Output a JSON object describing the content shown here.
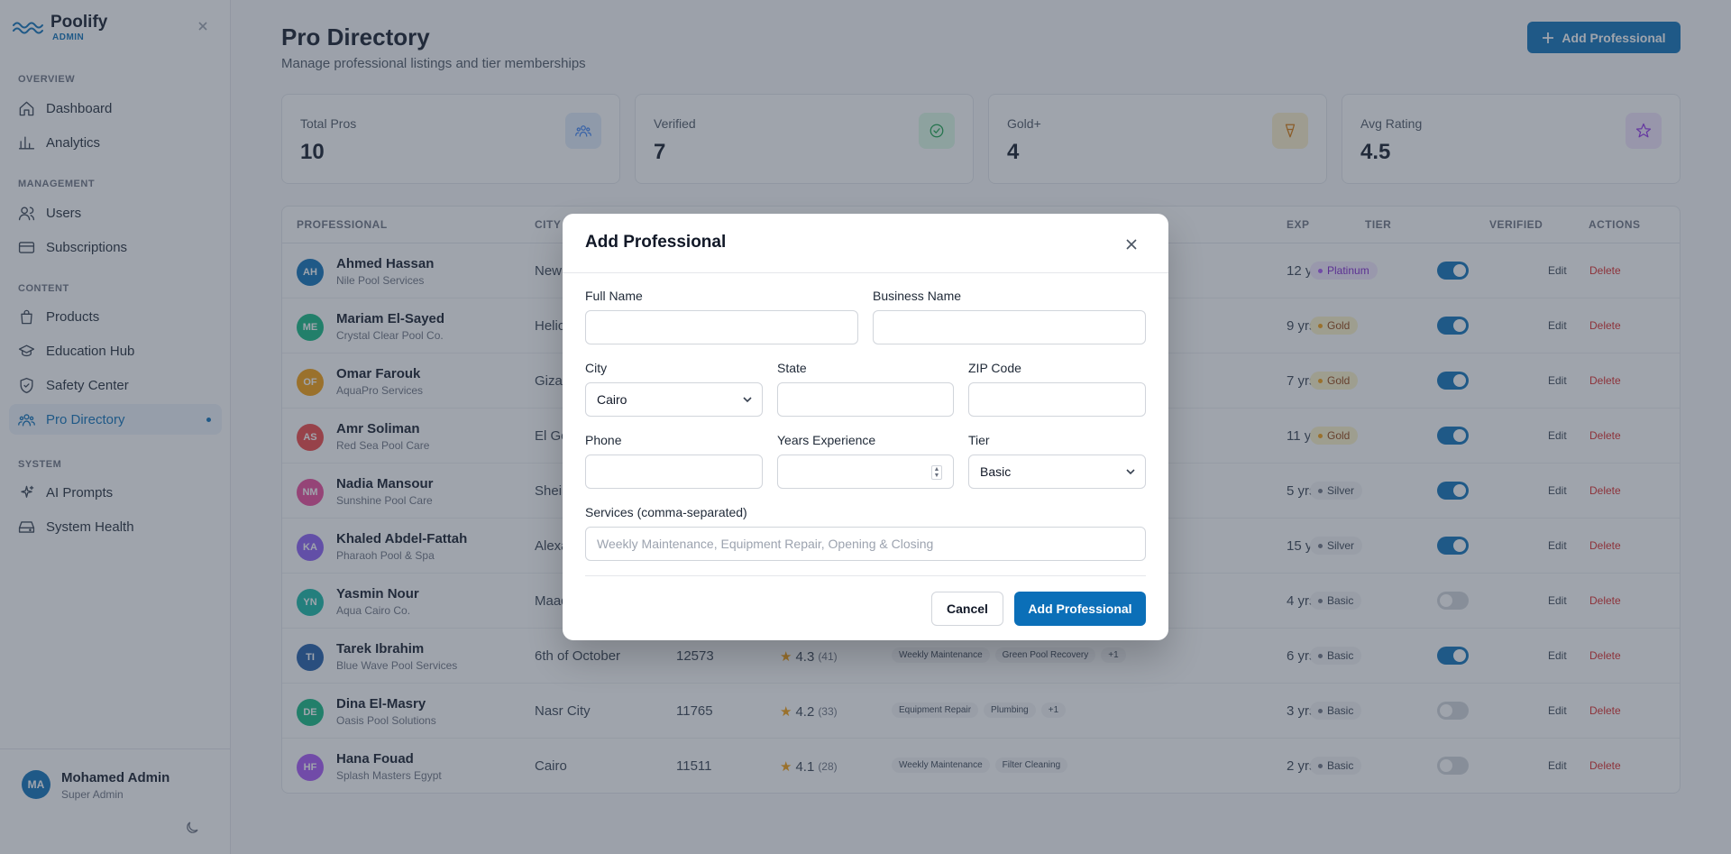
{
  "brand": {
    "name": "Poolify",
    "sub": "ADMIN"
  },
  "sidebar": {
    "sections": [
      {
        "title": "OVERVIEW",
        "items": [
          {
            "label": "Dashboard",
            "icon": "home-icon"
          },
          {
            "label": "Analytics",
            "icon": "bar-chart-icon"
          }
        ]
      },
      {
        "title": "MANAGEMENT",
        "items": [
          {
            "label": "Users",
            "icon": "users-icon"
          },
          {
            "label": "Subscriptions",
            "icon": "credit-card-icon"
          }
        ]
      },
      {
        "title": "CONTENT",
        "items": [
          {
            "label": "Products",
            "icon": "shopping-bag-icon"
          },
          {
            "label": "Education Hub",
            "icon": "graduation-cap-icon"
          },
          {
            "label": "Safety Center",
            "icon": "shield-icon"
          },
          {
            "label": "Pro Directory",
            "icon": "users-group-icon",
            "active": true
          }
        ]
      },
      {
        "title": "SYSTEM",
        "items": [
          {
            "label": "AI Prompts",
            "icon": "sparkles-icon"
          },
          {
            "label": "System Health",
            "icon": "hard-drive-icon"
          }
        ]
      }
    ],
    "user": {
      "initials": "MA",
      "name": "Mohamed Admin",
      "role": "Super Admin"
    }
  },
  "header": {
    "title": "Pro Directory",
    "subtitle": "Manage professional listings and tier memberships",
    "add_button": "Add Professional"
  },
  "stats": [
    {
      "label": "Total Pros",
      "value": "10",
      "color": "#3b82f6",
      "bg": "#e0ecfb",
      "icon": "users-group-icon"
    },
    {
      "label": "Verified",
      "value": "7",
      "color": "#16a34a",
      "bg": "#dcfce7",
      "icon": "check-circle-icon"
    },
    {
      "label": "Gold+",
      "value": "4",
      "color": "#d97706",
      "bg": "#fdefc9",
      "icon": "award-icon"
    },
    {
      "label": "Avg Rating",
      "value": "4.5",
      "color": "#9333ea",
      "bg": "#f1e4fd",
      "icon": "star-icon"
    }
  ],
  "table": {
    "columns": [
      "PROFESSIONAL",
      "CITY",
      "EXP",
      "TIER",
      "VERIFIED",
      "ACTIONS"
    ],
    "edit_label": "Edit",
    "delete_label": "Delete",
    "rows": [
      {
        "initials": "AH",
        "color": "#0b6fb8",
        "name": "Ahmed Hassan",
        "business": "Nile Pool Services",
        "city": "New",
        "zip": "",
        "rating": "",
        "reviews": "",
        "services": [],
        "exp": "12 yrs",
        "tier": "Platinum",
        "verified": true
      },
      {
        "initials": "ME",
        "color": "#10b981",
        "name": "Mariam El-Sayed",
        "business": "Crystal Clear Pool Co.",
        "city": "Helic",
        "zip": "",
        "rating": "",
        "reviews": "",
        "services": [],
        "exp": "9 yrs",
        "tier": "Gold",
        "verified": true
      },
      {
        "initials": "OF",
        "color": "#f59e0b",
        "name": "Omar Farouk",
        "business": "AquaPro Services",
        "city": "Giza",
        "zip": "",
        "rating": "",
        "reviews": "",
        "services": [],
        "exp": "7 yrs",
        "tier": "Gold",
        "verified": true
      },
      {
        "initials": "AS",
        "color": "#ef4444",
        "name": "Amr Soliman",
        "business": "Red Sea Pool Care",
        "city": "El Go",
        "zip": "",
        "rating": "",
        "reviews": "",
        "services": [],
        "exp": "11 yrs",
        "tier": "Gold",
        "verified": true
      },
      {
        "initials": "NM",
        "color": "#ec4899",
        "name": "Nadia Mansour",
        "business": "Sunshine Pool Care",
        "city": "Sheik",
        "zip": "",
        "rating": "",
        "reviews": "",
        "services": [],
        "exp": "5 yrs",
        "tier": "Silver",
        "verified": true
      },
      {
        "initials": "KA",
        "color": "#8b5cf6",
        "name": "Khaled Abdel-Fattah",
        "business": "Pharaoh Pool & Spa",
        "city": "Alexa",
        "zip": "",
        "rating": "",
        "reviews": "",
        "services": [],
        "exp": "15 yrs",
        "tier": "Silver",
        "verified": true
      },
      {
        "initials": "YN",
        "color": "#14b8a6",
        "name": "Yasmin Nour",
        "business": "Aqua Cairo Co.",
        "city": "Maad",
        "zip": "",
        "rating": "",
        "reviews": "",
        "services": [],
        "exp": "4 yrs",
        "tier": "Basic",
        "verified": false
      },
      {
        "initials": "TI",
        "color": "#1e5aa8",
        "name": "Tarek Ibrahim",
        "business": "Blue Wave Pool Services",
        "city": "6th of October",
        "zip": "12573",
        "rating": "4.3",
        "reviews": "(41)",
        "services": [
          "Weekly Maintenance",
          "Green Pool Recovery",
          "+1"
        ],
        "exp": "6 yrs",
        "tier": "Basic",
        "verified": true
      },
      {
        "initials": "DE",
        "color": "#10b981",
        "name": "Dina El-Masry",
        "business": "Oasis Pool Solutions",
        "city": "Nasr City",
        "zip": "11765",
        "rating": "4.2",
        "reviews": "(33)",
        "services": [
          "Equipment Repair",
          "Plumbing",
          "+1"
        ],
        "exp": "3 yrs",
        "tier": "Basic",
        "verified": false
      },
      {
        "initials": "HF",
        "color": "#a855f7",
        "name": "Hana Fouad",
        "business": "Splash Masters Egypt",
        "city": "Cairo",
        "zip": "11511",
        "rating": "4.1",
        "reviews": "(28)",
        "services": [
          "Weekly Maintenance",
          "Filter Cleaning"
        ],
        "exp": "2 yrs",
        "tier": "Basic",
        "verified": false
      }
    ]
  },
  "tiers": {
    "Platinum": {
      "bg": "#f3e8ff",
      "fg": "#7e22ce",
      "dot": "#a855f7"
    },
    "Gold": {
      "bg": "#fef3c7",
      "fg": "#92400e",
      "dot": "#f59e0b"
    },
    "Silver": {
      "bg": "#f3f4f6",
      "fg": "#374151",
      "dot": "#6b7280"
    },
    "Basic": {
      "bg": "#f3f4f6",
      "fg": "#374151",
      "dot": "#6b7280"
    }
  },
  "colors": {
    "accent": "#0b6fb8",
    "toggle_on": "#0b6fb8",
    "toggle_off": "#d1d5db"
  },
  "modal": {
    "title": "Add Professional",
    "full_name_label": "Full Name",
    "business_name_label": "Business Name",
    "city_label": "City",
    "city_value": "Cairo",
    "state_label": "State",
    "zip_label": "ZIP Code",
    "phone_label": "Phone",
    "years_label": "Years Experience",
    "tier_label": "Tier",
    "tier_value": "Basic",
    "services_label": "Services (comma-separated)",
    "services_placeholder": "Weekly Maintenance, Equipment Repair, Opening & Closing",
    "cancel_label": "Cancel",
    "submit_label": "Add Professional"
  }
}
